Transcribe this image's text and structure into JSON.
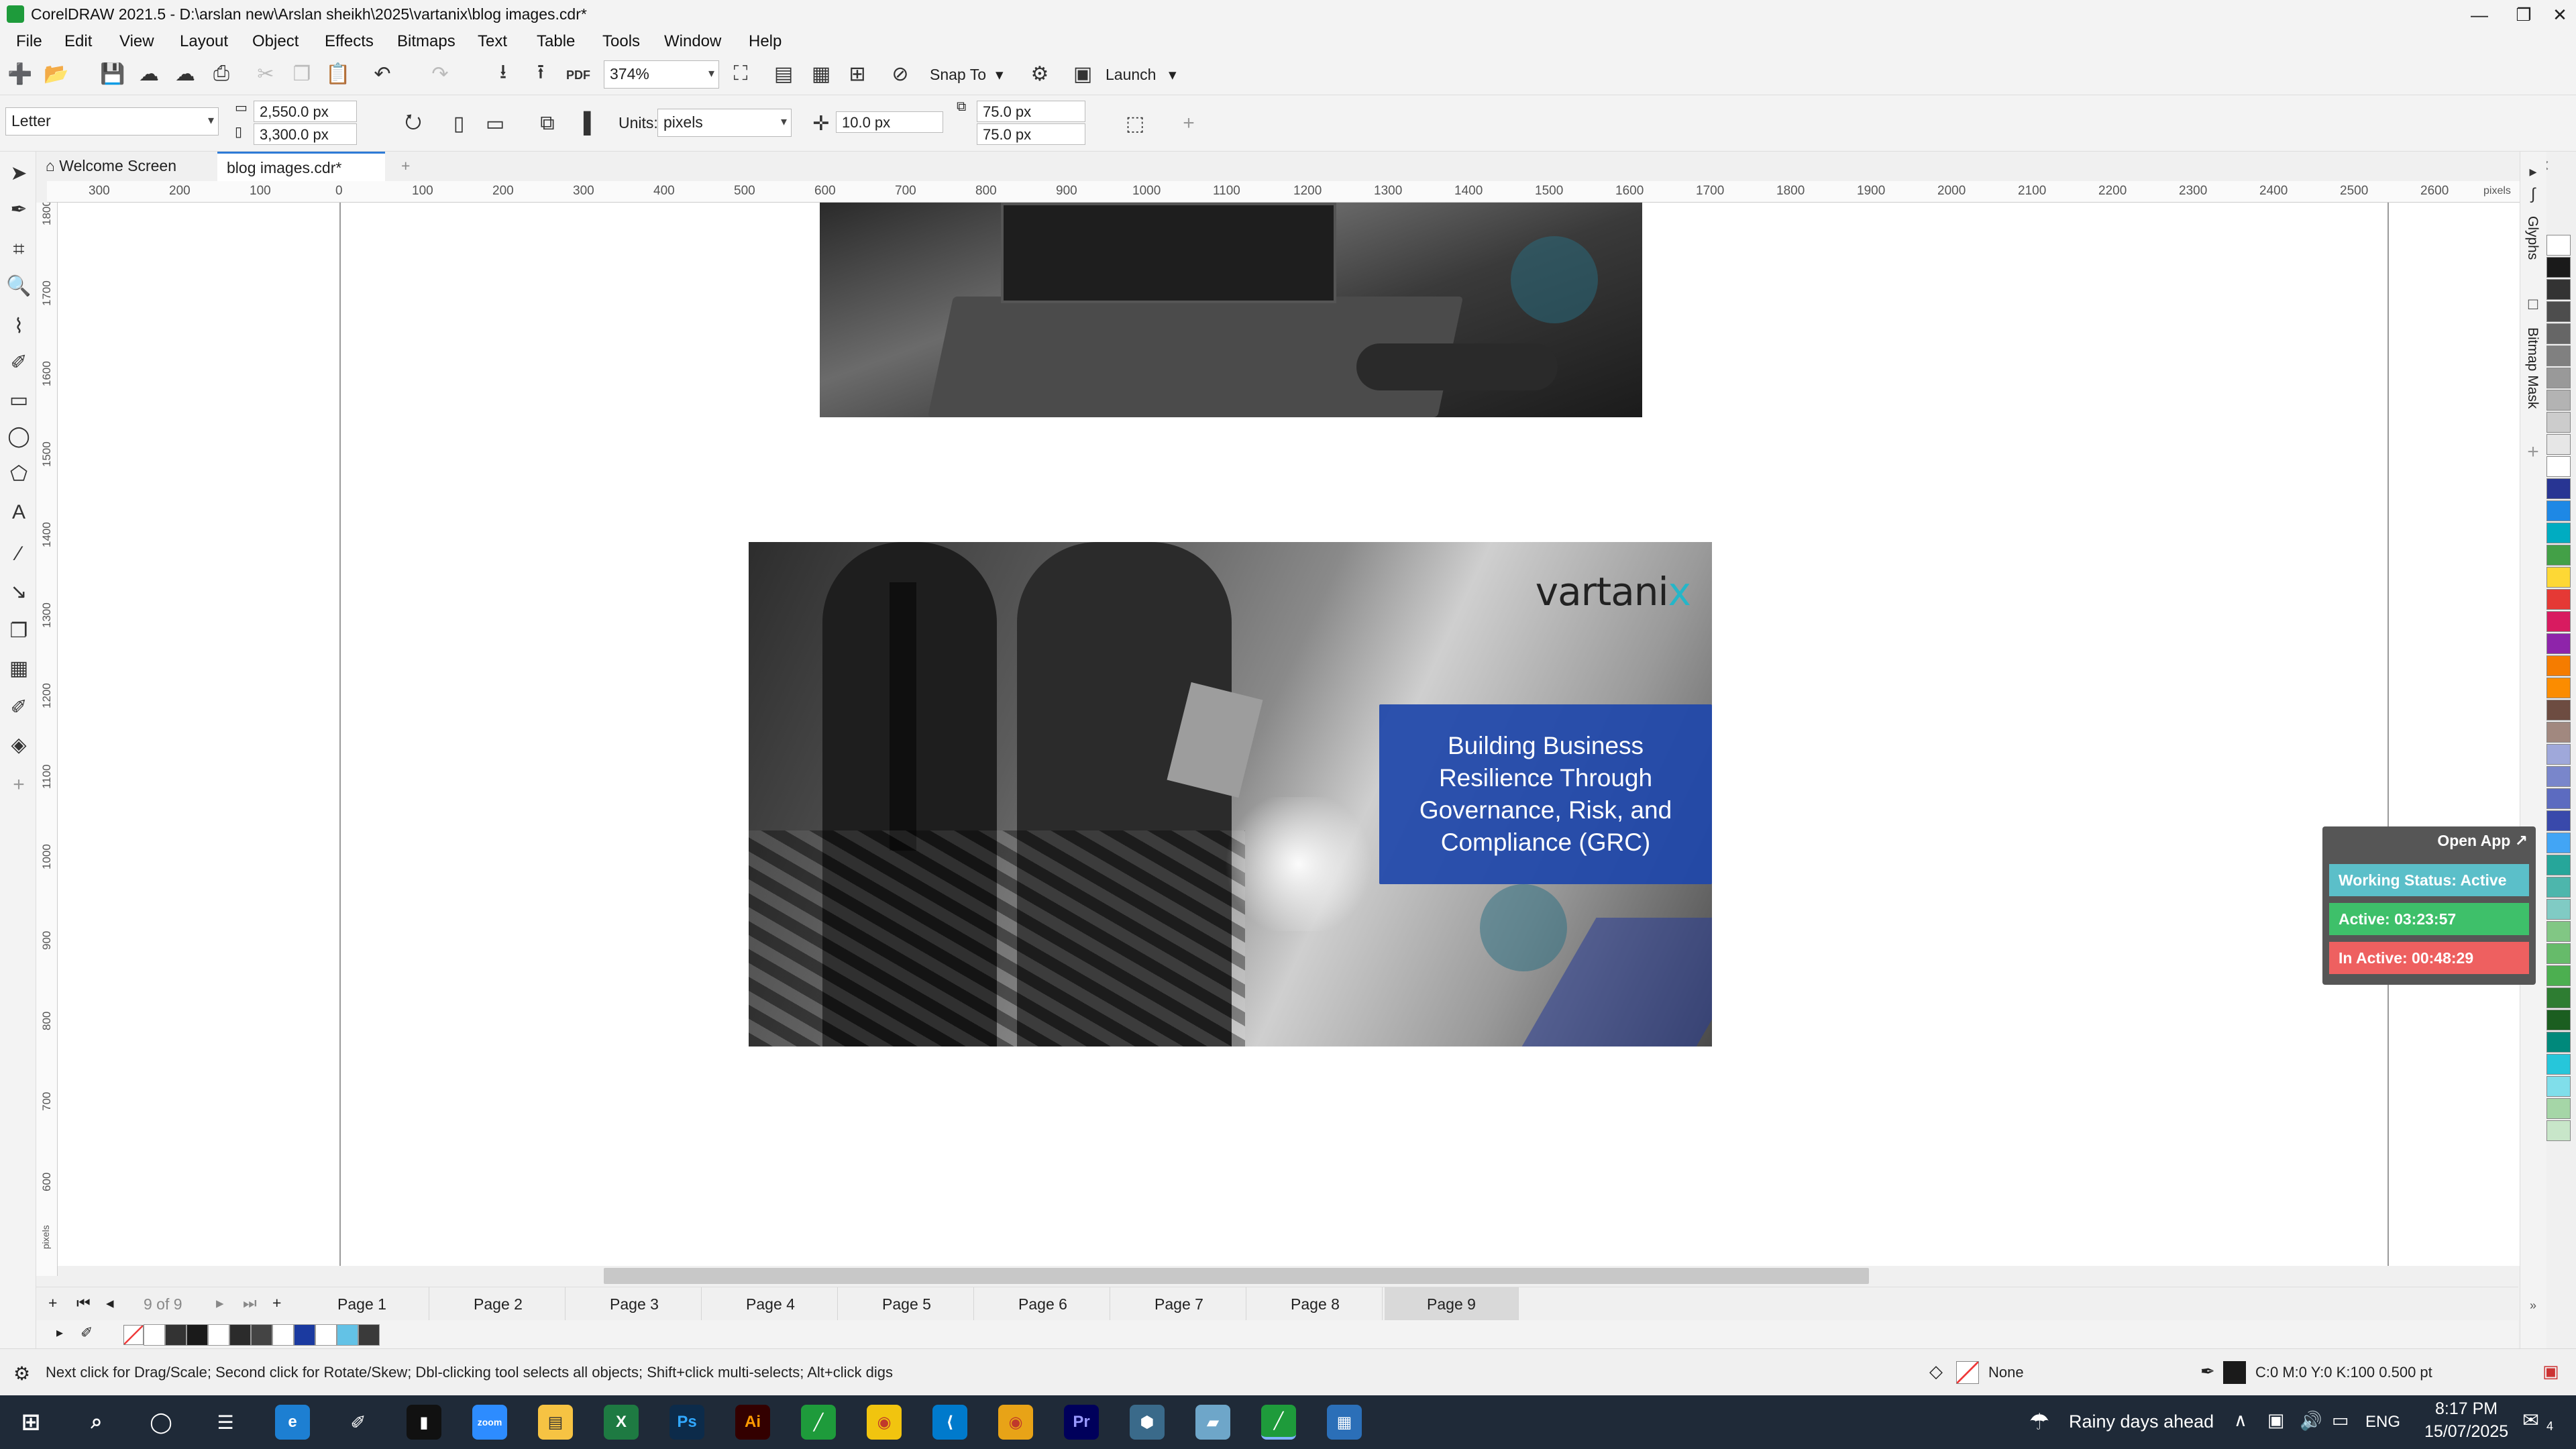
{
  "window": {
    "title": "CorelDRAW 2021.5 - D:\\arslan new\\Arslan sheikh\\2025\\vartanix\\blog images.cdr*",
    "controls": [
      "—",
      "❐",
      "✕"
    ]
  },
  "menu": [
    "File",
    "Edit",
    "View",
    "Layout",
    "Object",
    "Effects",
    "Bitmaps",
    "Text",
    "Table",
    "Tools",
    "Window",
    "Help"
  ],
  "toolbar": {
    "zoom": "374%",
    "snap_to": "Snap To",
    "launch": "Launch",
    "pdf": "PDF"
  },
  "propbar": {
    "page_size": "Letter",
    "width": "2,550.0 px",
    "height": "3,300.0 px",
    "units_label": "Units:",
    "units": "pixels",
    "nudge": "10.0 px",
    "dup_x": "75.0 px",
    "dup_y": "75.0 px"
  },
  "tabs": {
    "welcome": "Welcome Screen",
    "document": "blog images.cdr*"
  },
  "ruler": {
    "h_labels": [
      "300",
      "200",
      "100",
      "0",
      "100",
      "200",
      "300",
      "400",
      "500",
      "600",
      "700",
      "800",
      "900",
      "1000",
      "1100",
      "1200",
      "1300",
      "1400",
      "1500",
      "1600",
      "1700",
      "1800",
      "1900",
      "2000",
      "2100",
      "2200",
      "2300",
      "2400",
      "2500",
      "2600"
    ],
    "h_unit": "pixels",
    "v_labels": [
      "1800",
      "1700",
      "1600",
      "1500",
      "1400",
      "1300",
      "1200",
      "1100",
      "1000",
      "900",
      "800",
      "700",
      "600"
    ],
    "v_unit": "pixels"
  },
  "artwork": {
    "logo_main": "vartani",
    "logo_x": "x",
    "headline": "Building Business Resilience Through Governance, Risk, and Compliance (GRC)"
  },
  "docker": {
    "glyphs": "Glyphs",
    "bitmap_mask": "Bitmap Mask"
  },
  "palette_colors": [
    "#ffffff",
    "#1a1a1a",
    "#333333",
    "#4d4d4d",
    "#666666",
    "#808080",
    "#999999",
    "#b3b3b3",
    "#cccccc",
    "#e6e6e6",
    "#ffffff",
    "#283593",
    "#1e88e5",
    "#00acc1",
    "#43a047",
    "#fdd835",
    "#e53935",
    "#d81b60",
    "#8e24aa",
    "#f57c00",
    "#fb8c00",
    "#6d4c41",
    "#a1887f",
    "#9fa8da",
    "#7986cb",
    "#5c6bc0",
    "#3949ab",
    "#42a5f5",
    "#26a69a",
    "#4db6ac",
    "#80cbc4",
    "#81c784",
    "#66bb6a",
    "#4caf50",
    "#2e7d32",
    "#1b5e20",
    "#00897b",
    "#26c6da",
    "#80deea",
    "#a5d6a7",
    "#c8e6c9"
  ],
  "widget": {
    "open_app": "Open App ↗",
    "working_status": "Working Status: Active",
    "active": "Active: 03:23:57",
    "inactive": "In Active: 00:48:29",
    "colors": {
      "working": "#5bbfc9",
      "active": "#3ec06a",
      "inactive": "#ee6060"
    }
  },
  "pages": {
    "counter": "9 of 9",
    "tabs": [
      "Page 1",
      "Page 2",
      "Page 3",
      "Page 4",
      "Page 5",
      "Page 6",
      "Page 7",
      "Page 8",
      "Page 9"
    ],
    "active_index": 8
  },
  "doc_palette": [
    "#ffffff",
    "#333333",
    "#1a1a1a",
    "#ffffff",
    "#2b2b2b",
    "#444444",
    "#ffffff",
    "#1b3aa0",
    "#ffffff",
    "#63c2e6",
    "#3a3a3a"
  ],
  "status": {
    "hint": "Next click for Drag/Scale; Second click for Rotate/Skew; Dbl-clicking tool selects all objects; Shift+click multi-selects; Alt+click digs",
    "fill": "None",
    "outline": "C:0 M:0 Y:0 K:100  0.500 pt"
  },
  "taskbar": {
    "weather": "Rainy days ahead",
    "lang": "ENG",
    "time": "8:17 PM",
    "date": "15/07/2025",
    "notif_count": "4"
  }
}
